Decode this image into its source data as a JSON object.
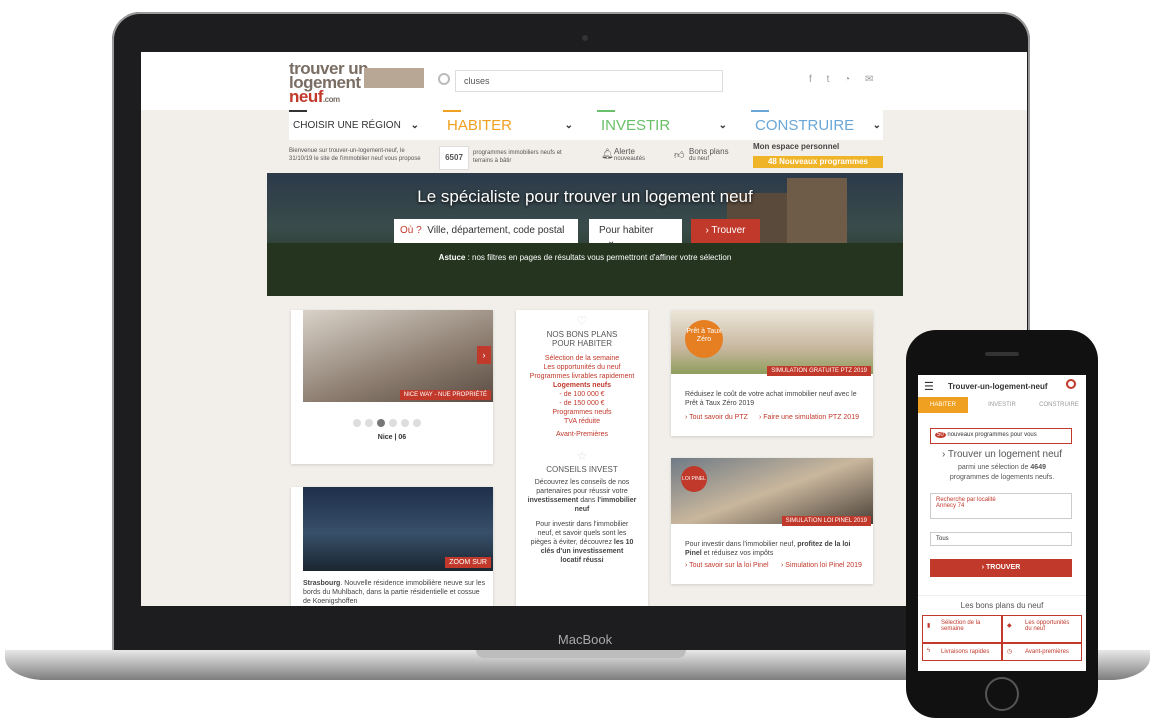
{
  "laptop": {
    "brand": "MacBook"
  },
  "site": {
    "logo_line1": "trouver un",
    "logo_line2": "logement",
    "logo_line3": "neuf",
    "logo_com": ".com",
    "search_value": "cluses",
    "social_icons": [
      "facebook-icon",
      "twitter-icon",
      "rss-icon",
      "mail-icon"
    ],
    "nav": [
      {
        "label": "CHOISIR UNE RÉGION",
        "color": "#333333"
      },
      {
        "label": "HABITER",
        "color": "#f0a020"
      },
      {
        "label": "INVESTIR",
        "color": "#6abf69"
      },
      {
        "label": "CONSTRUIRE",
        "color": "#6aa6d6"
      }
    ],
    "welcome_text": "Bienvenue sur trouver-un-logement-neuf, le 31/10/19 le site de l'immobilier neuf vous propose",
    "count": "6507",
    "count_text": "programmes immobiliers neufs et terrains à bâtir",
    "alerte": "Alerte",
    "alerte_sub": "nouveautés",
    "bons_plans": "Bons plans",
    "bons_plans_sub": "du neuf",
    "espace": "Mon espace personnel",
    "nouveaux": "48 Nouveaux programmes",
    "hero": {
      "title": "Le spécialiste pour trouver un logement neuf",
      "ou": "Où ?",
      "placeholder": "Ville, département, code postal",
      "select": "Pour habiter",
      "button": "› Trouver",
      "tip_bold": "Astuce",
      "tip": " : nos filtres en pages de résultats vous permettront d'affiner votre sélection"
    },
    "card1": {
      "tag": "NICE WAY - NUE PROPRIÉTÉ",
      "city": "Nice | 06"
    },
    "card2": {
      "tag": "ZOOM SUR",
      "city": "Strasbourg",
      "text": ". Nouvelle résidence immobilière neuve sur les bords du Muhlbach, dans la partie résidentielle et",
      "text2": "cossue de Koenigshoffen"
    },
    "bons": {
      "title": "NOS BONS PLANS POUR HABITER",
      "items": [
        "Sélection de la semaine",
        "Les opportunités du neuf",
        "Programmes livrables rapidement"
      ],
      "logements": "Logements neufs",
      "prices": [
        "- de 100 000 €",
        "- de 150 000 €"
      ],
      "programmes": "Programmes neufs",
      "tva": "TVA réduite",
      "avant": "Avant-Premières",
      "conseils_title": "CONSEILS INVEST",
      "conseils1": "Découvrez les conseils de nos partenaires pour réussir votre",
      "conseils1b": "investissement",
      "conseils1c": " dans ",
      "conseils1d": "l'immobilier neuf",
      "conseils2": "Pour investir dans l'immobilier neuf, et savoir quels sont les pièges à éviter, découvrez",
      "conseils2b": "les 10 clés d'un investissement locatif réussi"
    },
    "ptz": {
      "badge": "Prêt à Taux Zéro",
      "tag": "SIMULATION GRATUITE PTZ 2019",
      "text": "Réduisez le coût de votre achat immobilier neuf avec le Prêt à Taux Zéro 2019",
      "link1": "› Tout savoir du PTZ",
      "link2": "› Faire une simulation PTZ 2019"
    },
    "pinel": {
      "badge": "LOI PINEL",
      "tag": "SIMULATION LOI PINEL 2019",
      "text1": "Pour investir dans l'immobilier neuf, ",
      "text_bold": "profitez de la loi Pinel",
      "text2": " et réduisez vos impôts",
      "link1": "› Tout savoir sur la loi Pinel",
      "link2": "› Simulation loi Pinel 2019"
    }
  },
  "phone": {
    "title": "Trouver-un-logement-neuf",
    "tabs": [
      "HABITER",
      "INVESTIR",
      "CONSTRUIRE"
    ],
    "badge_count": "50",
    "badge_text": "nouveaux programmes pour vous",
    "headline": "› Trouver un logement neuf",
    "sub1": "parmi une sélection de ",
    "sub_count": "4649",
    "sub2": "programmes de logements neufs.",
    "search_label": "Recherche par localité",
    "search_value": "Annecy 74",
    "select": "Tous",
    "button": "› TROUVER",
    "bons_title": "Les bons plans du neuf",
    "items": [
      "Sélection de la semaine",
      "Les opportunités du neuf",
      "Livraisons rapides",
      "Avant-premières"
    ]
  }
}
